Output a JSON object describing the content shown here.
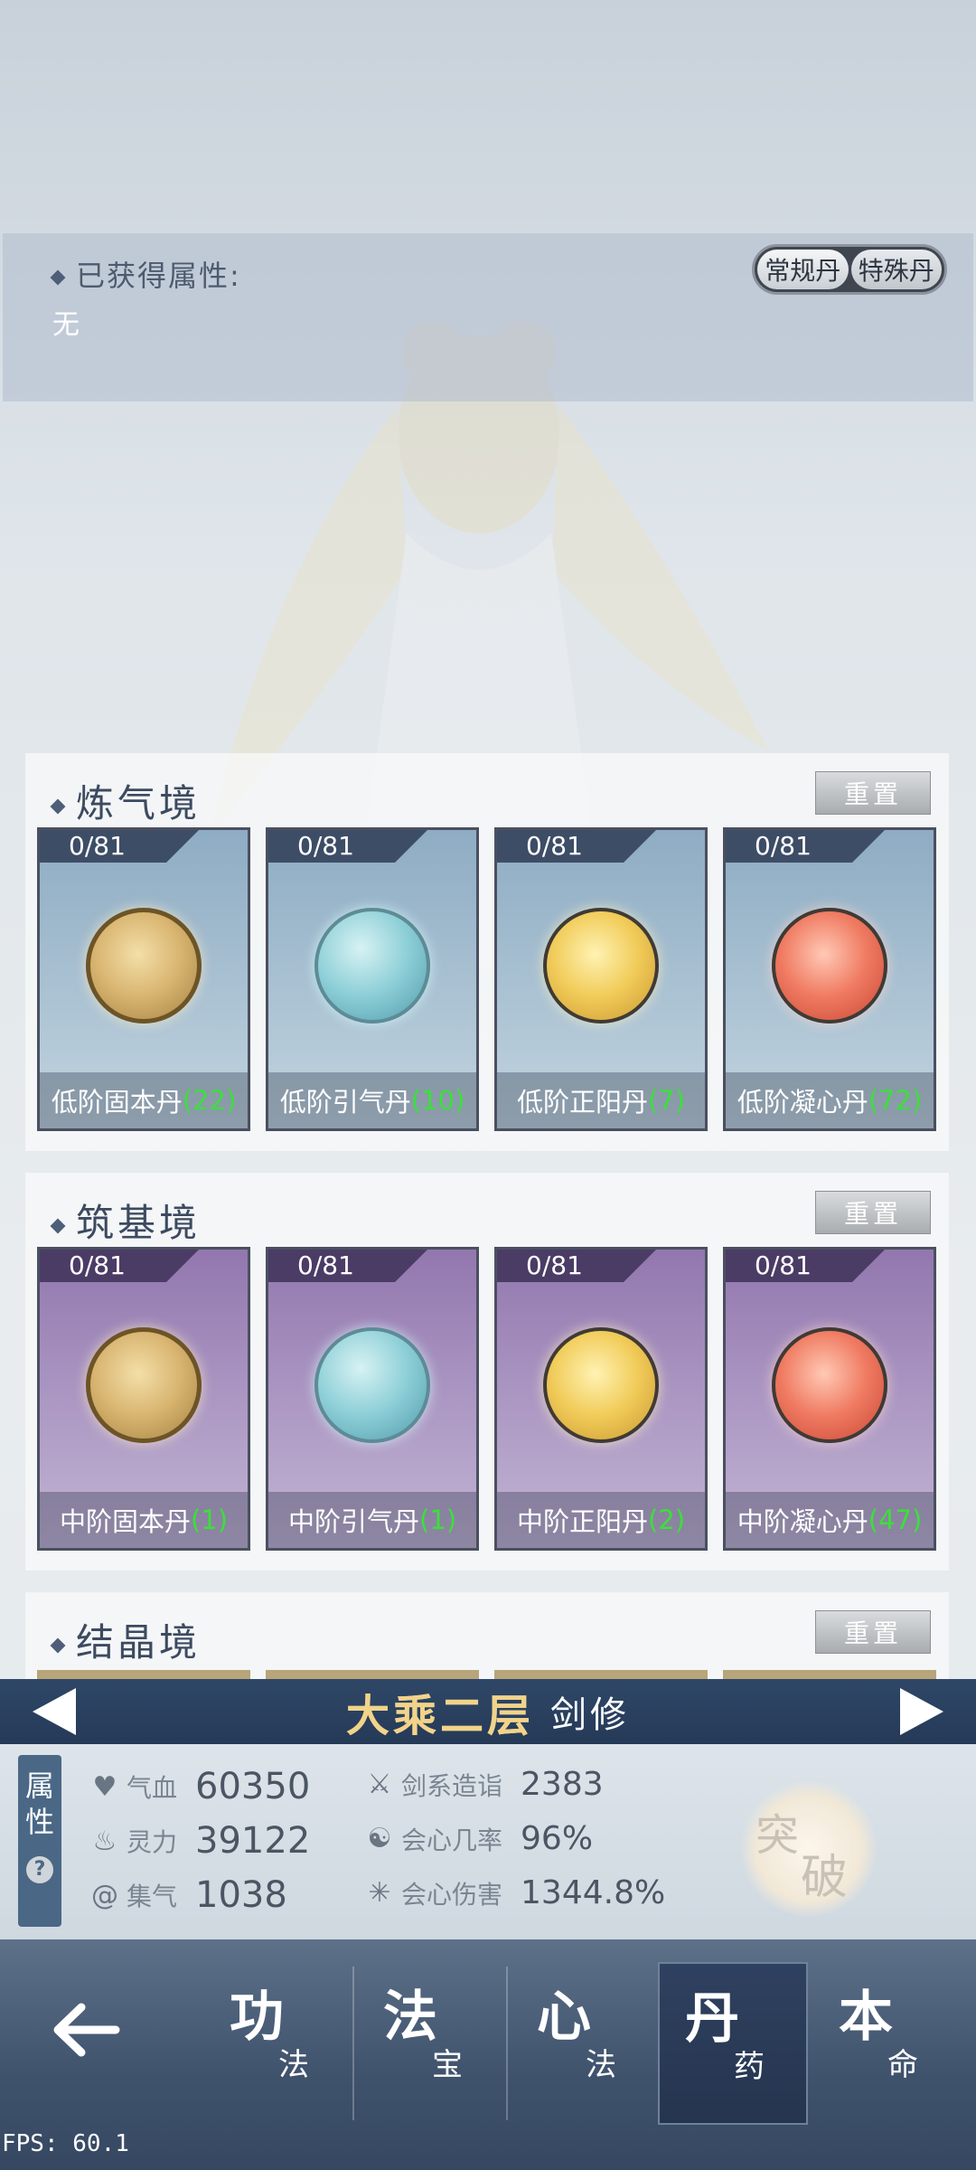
{
  "attributes_panel": {
    "title": "已获得属性:",
    "value": "无",
    "toggle": [
      "常规丹",
      "特殊丹"
    ]
  },
  "sections": [
    {
      "title": "炼气境",
      "reset_label": "重置",
      "theme": "blue",
      "cards": [
        {
          "count": "0/81",
          "name": "低阶固本丹",
          "qty": "(22)",
          "orb": "gold-vine"
        },
        {
          "count": "0/81",
          "name": "低阶引气丹",
          "qty": "(10)",
          "orb": "teal"
        },
        {
          "count": "0/81",
          "name": "低阶正阳丹",
          "qty": "(7)",
          "orb": "yellow"
        },
        {
          "count": "0/81",
          "name": "低阶凝心丹",
          "qty": "(72)",
          "orb": "red"
        }
      ]
    },
    {
      "title": "筑基境",
      "reset_label": "重置",
      "theme": "purple",
      "cards": [
        {
          "count": "0/81",
          "name": "中阶固本丹",
          "qty": "(1)",
          "orb": "gold-vine"
        },
        {
          "count": "0/81",
          "name": "中阶引气丹",
          "qty": "(1)",
          "orb": "teal"
        },
        {
          "count": "0/81",
          "name": "中阶正阳丹",
          "qty": "(2)",
          "orb": "yellow"
        },
        {
          "count": "0/81",
          "name": "中阶凝心丹",
          "qty": "(47)",
          "orb": "red"
        }
      ]
    },
    {
      "title": "结晶境",
      "reset_label": "重置"
    }
  ],
  "realm": {
    "name": "大乘二层",
    "class": "剑修"
  },
  "stats": {
    "tab": [
      "属",
      "性"
    ],
    "help": "?",
    "left": [
      {
        "label": "气血",
        "value": "60350",
        "icon": "heart-icon"
      },
      {
        "label": "灵力",
        "value": "39122",
        "icon": "flame-icon"
      },
      {
        "label": "集气",
        "value": "1038",
        "icon": "swirl-icon"
      }
    ],
    "right": [
      {
        "label": "剑系造诣",
        "value": "2383",
        "icon": "sword-icon"
      },
      {
        "label": "会心几率",
        "value": "96%",
        "icon": "crit-rate-icon"
      },
      {
        "label": "会心伤害",
        "value": "1344.8%",
        "icon": "crit-damage-icon"
      }
    ],
    "breakthrough": [
      "突",
      "破"
    ]
  },
  "nav": [
    {
      "big": "功",
      "small": "法",
      "active": false
    },
    {
      "big": "法",
      "small": "宝",
      "active": false
    },
    {
      "big": "心",
      "small": "法",
      "active": false
    },
    {
      "big": "丹",
      "small": "药",
      "active": true
    },
    {
      "big": "本",
      "small": "命",
      "active": false
    }
  ],
  "fps": "FPS: 60.1"
}
